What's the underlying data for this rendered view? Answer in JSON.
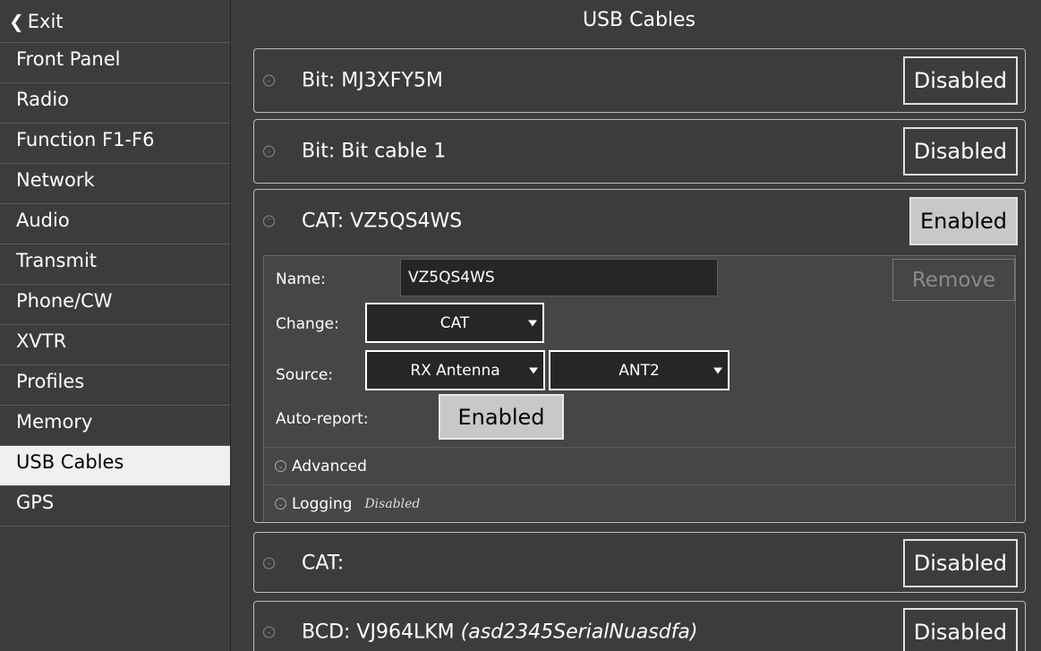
{
  "sidebar": {
    "exit_label": "Exit",
    "items": [
      {
        "label": "Front Panel"
      },
      {
        "label": "Radio"
      },
      {
        "label": "Function F1-F6"
      },
      {
        "label": "Network"
      },
      {
        "label": "Audio"
      },
      {
        "label": "Transmit"
      },
      {
        "label": "Phone/CW"
      },
      {
        "label": "XVTR"
      },
      {
        "label": "Profiles"
      },
      {
        "label": "Memory"
      },
      {
        "label": "USB Cables",
        "active": true
      },
      {
        "label": "GPS"
      }
    ]
  },
  "main": {
    "title": "USB Cables",
    "cables": [
      {
        "type": "Bit:",
        "name": "MJ3XFY5M",
        "state": "Disabled"
      },
      {
        "type": "Bit:",
        "name": "Bit cable 1",
        "state": "Disabled"
      },
      {
        "type": "CAT:",
        "name": "VZ5QS4WS",
        "state": "Enabled"
      },
      {
        "type": "CAT:",
        "name": "",
        "state": "Disabled"
      },
      {
        "type": "BCD:",
        "name": "VJ964LKM",
        "serial": "(asd2345SerialNuasdfa)",
        "state": "Disabled"
      }
    ],
    "expanded": {
      "name_label": "Name:",
      "name_value": "VZ5QS4WS",
      "remove_label": "Remove",
      "change_label": "Change:",
      "change_value": "CAT",
      "source_label": "Source:",
      "source_value": "RX Antenna",
      "antenna_value": "ANT2",
      "auto_report_label": "Auto-report:",
      "auto_report_value": "Enabled",
      "advanced_label": "Advanced",
      "logging_label": "Logging",
      "logging_state": "Disabled"
    }
  },
  "colors": {
    "background": "#3c3c3c",
    "active_item_bg": "#f0f0f0",
    "enabled_button_bg": "#c8c8c8",
    "field_bg": "#262626"
  },
  "icons": {
    "exit": "chevron-left-icon",
    "collapse": "circle-chevron-icon",
    "dropdown": "caret-down-icon"
  }
}
